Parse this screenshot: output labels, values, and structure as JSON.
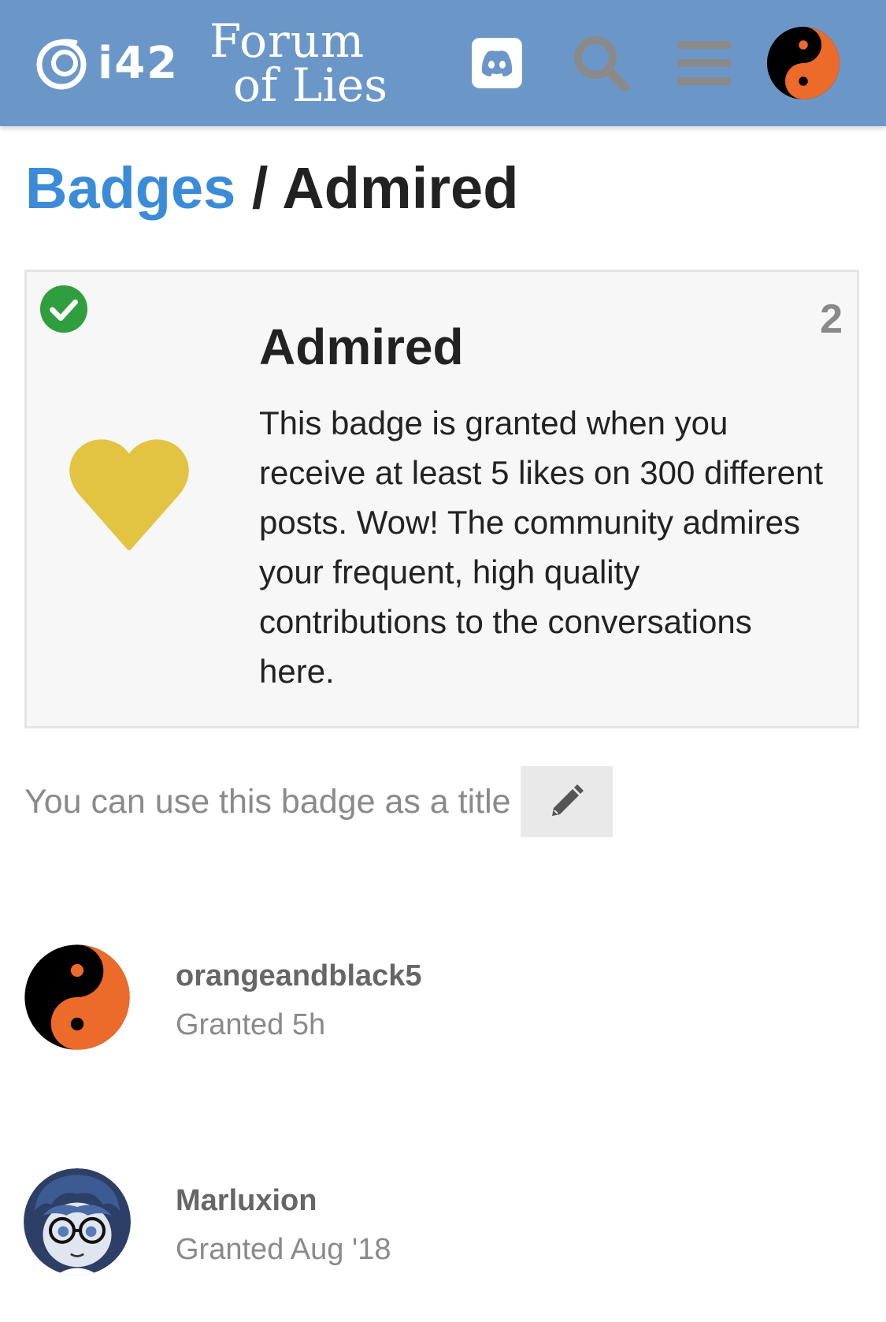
{
  "header": {
    "logo_text": "i42",
    "site_logo_line1": "Forum",
    "site_logo_line2": "of Lies",
    "icons": [
      "discord-icon",
      "search-icon",
      "hamburger-menu-icon",
      "user-avatar-yin-yang"
    ]
  },
  "breadcrumb": {
    "parent": "Badges",
    "separator": " / ",
    "current": "Admired"
  },
  "badge": {
    "name": "Admired",
    "grant_count": "2",
    "granted_to_me": true,
    "icon": "heart-icon",
    "icon_color": "#e2c442",
    "description": "This badge is granted when you receive at least 5 likes on 300 different posts. Wow! The community admires your frequent, high quality contributions to the conversations here."
  },
  "title_notice": {
    "text": "You can use this badge as a title",
    "edit_icon": "pencil-icon"
  },
  "grantees": [
    {
      "username": "orangeandblack5",
      "granted": "Granted 5h",
      "avatar": "yin-yang-avatar"
    },
    {
      "username": "Marluxion",
      "granted": "Granted Aug '18",
      "avatar": "anime-character-avatar"
    }
  ],
  "colors": {
    "header_bg": "#6b97c8",
    "link_blue": "#3a8bd8",
    "check_green": "#2e9e3e",
    "avatar_orange": "#ec6a2a",
    "heart_gold": "#e2c442"
  }
}
